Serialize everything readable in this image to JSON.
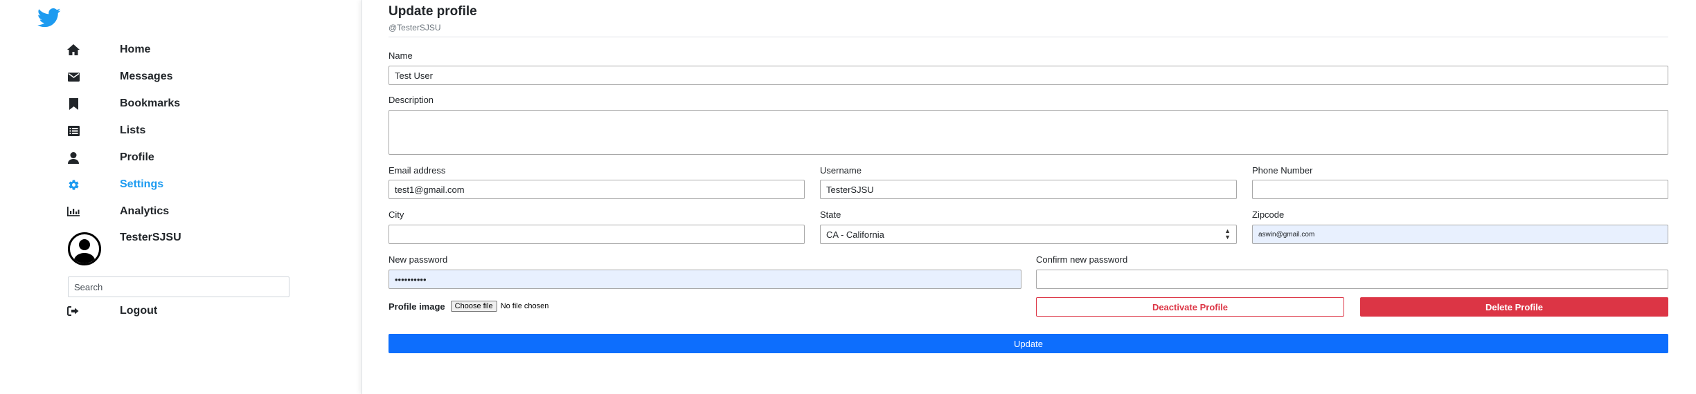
{
  "brand": {
    "icon": "twitter-bird-icon",
    "color": "#1d9bf0"
  },
  "nav": [
    {
      "label": "Home",
      "icon": "home-icon"
    },
    {
      "label": "Messages",
      "icon": "envelope-icon"
    },
    {
      "label": "Bookmarks",
      "icon": "bookmark-icon"
    },
    {
      "label": "Lists",
      "icon": "list-icon"
    },
    {
      "label": "Profile",
      "icon": "user-icon"
    },
    {
      "label": "Settings",
      "icon": "gear-icon",
      "active": true
    },
    {
      "label": "Analytics",
      "icon": "bar-chart-icon"
    }
  ],
  "user": {
    "name": "TesterSJSU",
    "avatar_icon": "user-avatar-icon"
  },
  "search": {
    "placeholder": "Search"
  },
  "logout": {
    "label": "Logout",
    "icon": "sign-out-icon"
  },
  "form": {
    "title": "Update profile",
    "handle": "@TesterSJSU",
    "name": {
      "label": "Name",
      "value": "Test User"
    },
    "description": {
      "label": "Description",
      "value": ""
    },
    "email": {
      "label": "Email address",
      "value": "test1@gmail.com"
    },
    "username": {
      "label": "Username",
      "value": "TesterSJSU"
    },
    "phone": {
      "label": "Phone Number",
      "value": ""
    },
    "city": {
      "label": "City",
      "value": ""
    },
    "state": {
      "label": "State",
      "value": "CA - California"
    },
    "zipcode": {
      "label": "Zipcode",
      "value": "aswin@gmail.com"
    },
    "new_password": {
      "label": "New password",
      "value": "••••••••••"
    },
    "confirm_password": {
      "label": "Confirm new password",
      "value": ""
    },
    "profile_image": {
      "label": "Profile image",
      "button": "Choose file",
      "status": "No file chosen"
    },
    "deactivate_label": "Deactivate Profile",
    "delete_label": "Delete Profile",
    "update_label": "Update"
  },
  "colors": {
    "primary": "#0d6efd",
    "danger": "#dc3545",
    "accent": "#1d9bf0",
    "autofill": "#e8f0fe"
  }
}
